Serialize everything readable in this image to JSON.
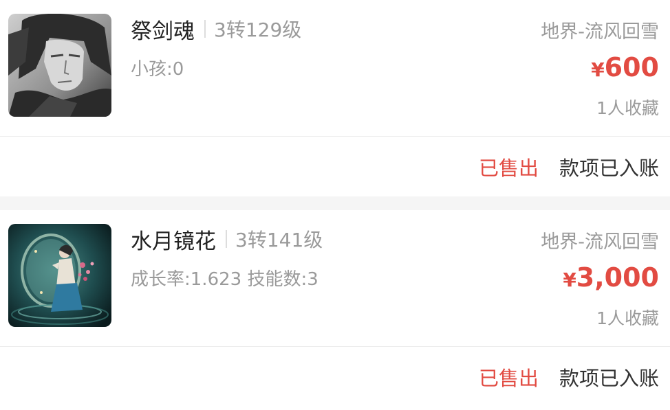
{
  "listings": [
    {
      "name": "祭剑魂",
      "level": "3转129级",
      "attributes": "小孩:0",
      "server": "地界-流风回雪",
      "price_symbol": "¥",
      "price": "600",
      "favorites": "1人收藏",
      "status": "已售出",
      "payment": "款项已入账",
      "image": "grayscale-swordsman-portrait"
    },
    {
      "name": "水月镜花",
      "level": "3转141级",
      "attributes": "成长率:1.623 技能数:3",
      "server": "地界-流风回雪",
      "price_symbol": "¥",
      "price": "3,000",
      "favorites": "1人收藏",
      "status": "已售出",
      "payment": "款项已入账",
      "image": "moon-mirror-fairy-portrait"
    }
  ],
  "colors": {
    "price": "#e24b42",
    "status_sold": "#e24b42",
    "secondary_text": "#9a9a9a",
    "primary_text": "#222222"
  }
}
